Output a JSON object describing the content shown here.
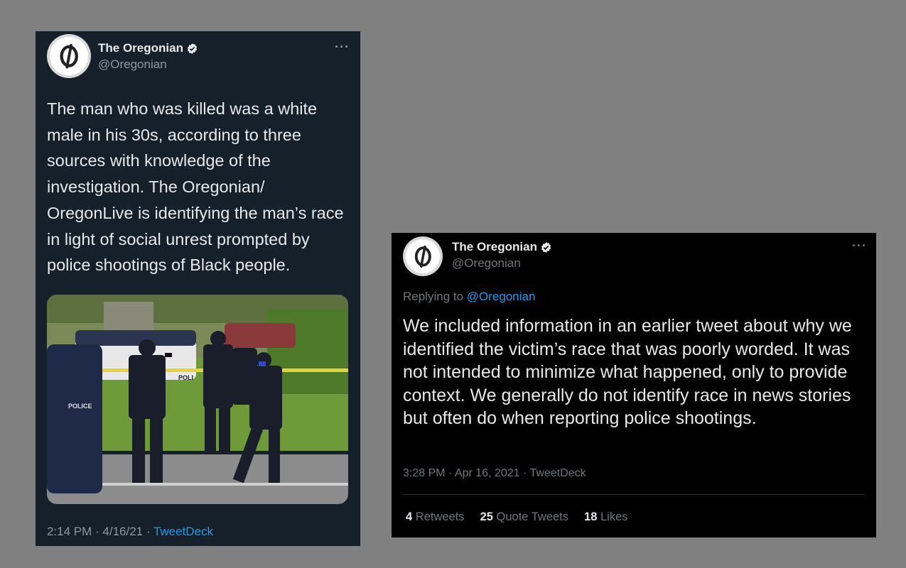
{
  "tweet1": {
    "name": "The Oregonian",
    "handle": "@Oregonian",
    "more": "···",
    "text": "The man who was killed was a white male in his 30s, according to three sources with knowledge of the investigation. The Oregonian/ OregonLive is identifying the man’s race in light of social unrest prompted by police shootings of Black people.",
    "time": "2:14 PM · 4/16/21 · ",
    "source": "TweetDeck",
    "photo_labels": {
      "car": "POLICE",
      "tape": "POLI"
    }
  },
  "tweet2": {
    "name": "The Oregonian",
    "handle": "@Oregonian",
    "more": "···",
    "replying_prefix": "Replying to ",
    "replying_to": "@Oregonian",
    "text": "We included information in an earlier tweet about why we identified the victim’s race that was poorly worded. It was not intended to minimize what happened, only to provide context. We generally do not identify race in news stories but often do when reporting police shootings.",
    "time": "3:28 PM · Apr 16, 2021 · TweetDeck",
    "stats": {
      "retweets_count": "4",
      "retweets_label": "Retweets",
      "quotes_count": "25",
      "quotes_label": "Quote Tweets",
      "likes_count": "18",
      "likes_label": "Likes"
    }
  },
  "colors": {
    "page_bg": "#808080",
    "dim_card_bg": "#15202b",
    "black_card_bg": "#000000",
    "link": "#1d9bf0",
    "verified_badge": "#e7e9ea"
  }
}
